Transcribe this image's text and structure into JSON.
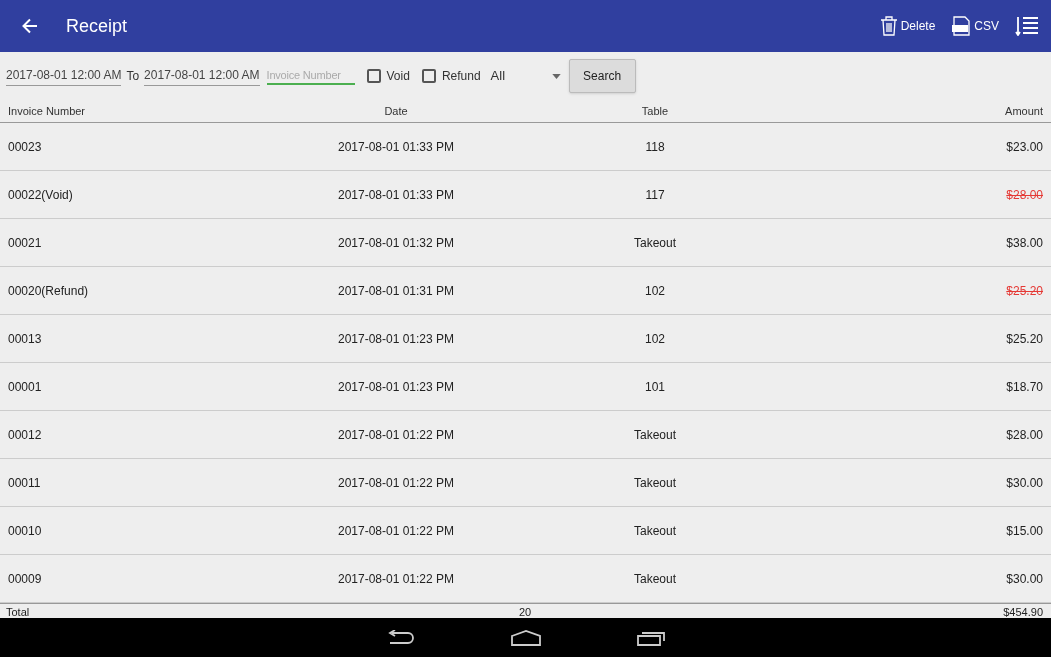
{
  "app_bar": {
    "title": "Receipt",
    "actions": [
      {
        "kind": "delete",
        "label": "Delete"
      },
      {
        "kind": "csv",
        "label": "CSV"
      },
      {
        "kind": "sort"
      }
    ]
  },
  "filters": {
    "from": "2017-08-01 12:00 AM",
    "to_label": "To",
    "to": "2017-08-01 12:00 AM",
    "invoice": {
      "placeholder": "Invoice Number"
    },
    "checkboxes": [
      {
        "label": "Void",
        "checked": false
      },
      {
        "label": "Refund",
        "checked": false
      }
    ],
    "dropdown": "All",
    "search_button": "Search"
  },
  "table": {
    "columns": [
      "Invoice Number",
      "Date",
      "Table",
      "Amount"
    ],
    "rows": [
      {
        "invoice": "00023",
        "date": "2017-08-01 01:33 PM",
        "table": "118",
        "amount": "$23.00",
        "struck": false
      },
      {
        "invoice": "00022(Void)",
        "date": "2017-08-01 01:33 PM",
        "table": "117",
        "amount": "$28.00",
        "struck": true
      },
      {
        "invoice": "00021",
        "date": "2017-08-01 01:32 PM",
        "table": "Takeout",
        "amount": "$38.00",
        "struck": false
      },
      {
        "invoice": "00020(Refund)",
        "date": "2017-08-01 01:31 PM",
        "table": "102",
        "amount": "$25.20",
        "struck": true
      },
      {
        "invoice": "00013",
        "date": "2017-08-01 01:23 PM",
        "table": "102",
        "amount": "$25.20",
        "struck": false
      },
      {
        "invoice": "00001",
        "date": "2017-08-01 01:23 PM",
        "table": "101",
        "amount": "$18.70",
        "struck": false
      },
      {
        "invoice": "00012",
        "date": "2017-08-01 01:22 PM",
        "table": "Takeout",
        "amount": "$28.00",
        "struck": false
      },
      {
        "invoice": "00011",
        "date": "2017-08-01 01:22 PM",
        "table": "Takeout",
        "amount": "$30.00",
        "struck": false
      },
      {
        "invoice": "00010",
        "date": "2017-08-01 01:22 PM",
        "table": "Takeout",
        "amount": "$15.00",
        "struck": false
      },
      {
        "invoice": "00009",
        "date": "2017-08-01 01:22 PM",
        "table": "Takeout",
        "amount": "$30.00",
        "struck": false
      }
    ],
    "total": {
      "label": "Total",
      "count": "20",
      "amount": "$454.90"
    }
  }
}
